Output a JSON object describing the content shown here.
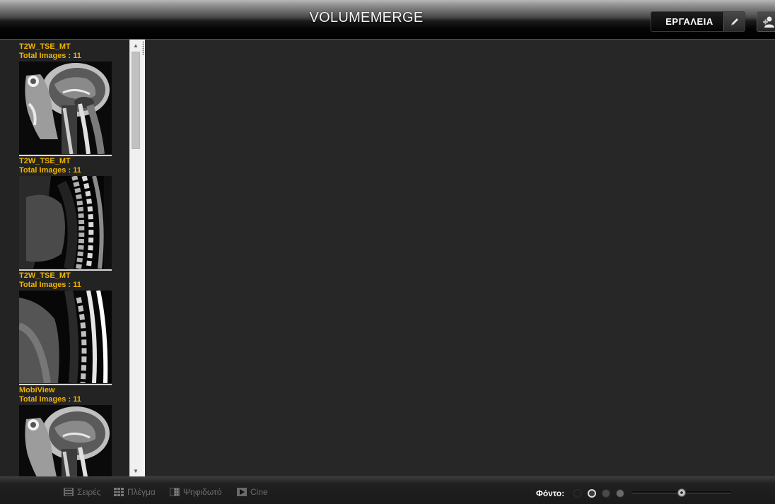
{
  "app": {
    "title": "VOLUMEMERGE"
  },
  "toolbar": {
    "tools_label": "ΕΡΓΑΛΕΙΑ",
    "tools_icon": "pencil-icon",
    "user_icon": "user-settings-icon"
  },
  "series": [
    {
      "name": "T2W_TSE_MT",
      "count_label": "Total Images : 11",
      "thumb": "sagittal-head-mri"
    },
    {
      "name": "T2W_TSE_MT",
      "count_label": "Total Images : 11",
      "thumb": "sagittal-thoracic-spine-mri"
    },
    {
      "name": "T2W_TSE_MT",
      "count_label": "Total Images : 11",
      "thumb": "sagittal-lumbar-spine-mri"
    },
    {
      "name": "MobiView",
      "count_label": "Total Images : 11",
      "thumb": "sagittal-head-mri"
    }
  ],
  "scroll": {
    "position": 0.0
  },
  "bottom_bar": {
    "buttons": [
      {
        "label": "Σειρές",
        "icon": "series-icon"
      },
      {
        "label": "Πλέγμα",
        "icon": "grid-icon"
      },
      {
        "label": "Ψηφιδωτό",
        "icon": "mosaic-icon"
      },
      {
        "label": "Cine",
        "icon": "play-icon"
      }
    ],
    "background_label": "Φόντο:",
    "background_options": [
      {
        "color": "#1e1e1e",
        "selected": false
      },
      {
        "color": "#3c3c3c",
        "selected": true
      },
      {
        "color": "#4a4a4a",
        "selected": false
      },
      {
        "color": "#6a6a6a",
        "selected": false
      }
    ],
    "slider_value": 0.5
  },
  "colors": {
    "series_text": "#f0b400",
    "panel_bg": "#232323",
    "viewer_bg": "#272727"
  }
}
